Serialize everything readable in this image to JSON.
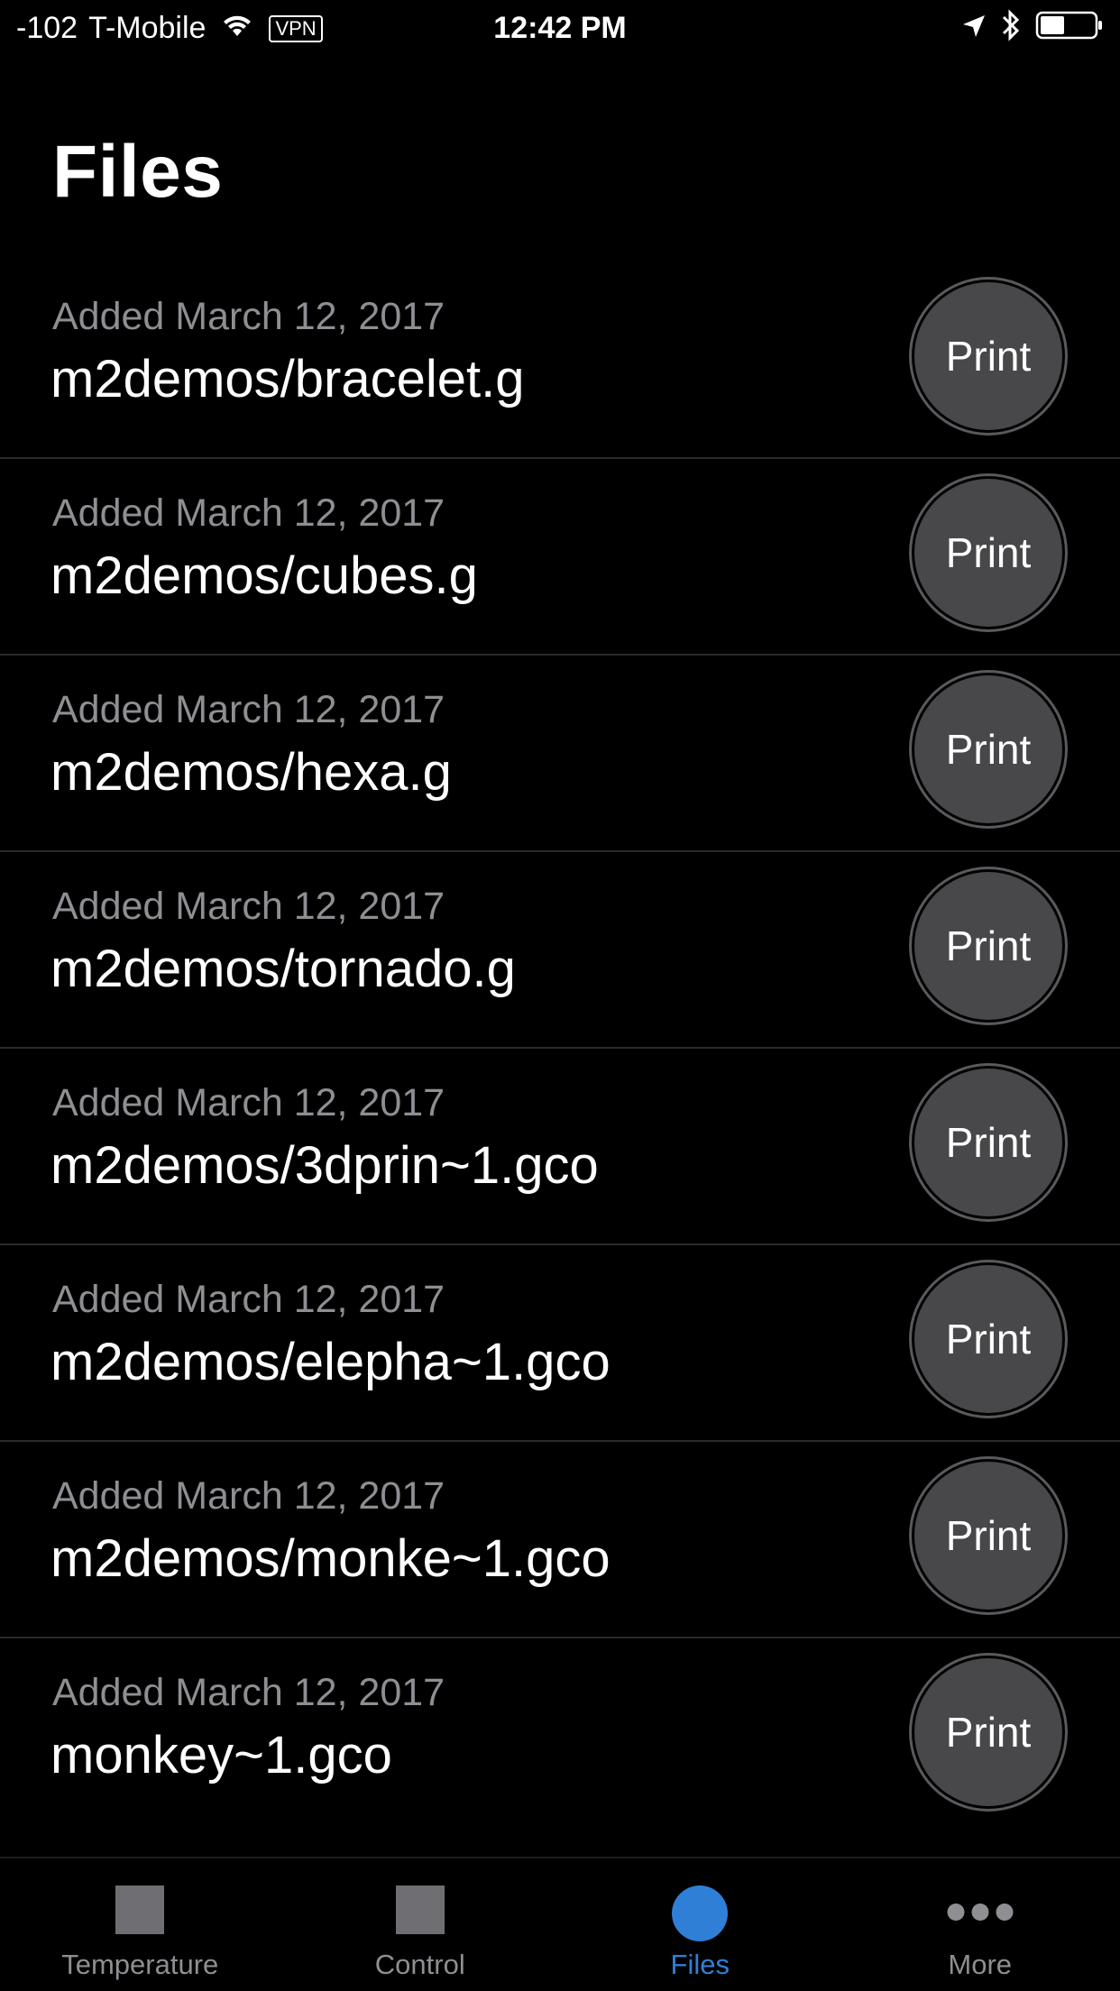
{
  "status_bar": {
    "signal": "-102",
    "carrier": "T-Mobile",
    "vpn": "VPN",
    "time": "12:42 PM"
  },
  "title": "Files",
  "files": [
    {
      "date": "Added March 12, 2017",
      "name": "m2demos/bracelet.g",
      "action": "Print"
    },
    {
      "date": "Added March 12, 2017",
      "name": "m2demos/cubes.g",
      "action": "Print"
    },
    {
      "date": "Added March 12, 2017",
      "name": "m2demos/hexa.g",
      "action": "Print"
    },
    {
      "date": "Added March 12, 2017",
      "name": "m2demos/tornado.g",
      "action": "Print"
    },
    {
      "date": "Added March 12, 2017",
      "name": "m2demos/3dprin~1.gco",
      "action": "Print"
    },
    {
      "date": "Added March 12, 2017",
      "name": "m2demos/elepha~1.gco",
      "action": "Print"
    },
    {
      "date": "Added March 12, 2017",
      "name": "m2demos/monke~1.gco",
      "action": "Print"
    },
    {
      "date": "Added March 12, 2017",
      "name": "monkey~1.gco",
      "action": "Print"
    }
  ],
  "tabs": [
    {
      "label": "Temperature",
      "icon": "square-icon",
      "active": false
    },
    {
      "label": "Control",
      "icon": "square-icon",
      "active": false
    },
    {
      "label": "Files",
      "icon": "circle-icon",
      "active": true
    },
    {
      "label": "More",
      "icon": "more-dots-icon",
      "active": false
    }
  ],
  "colors": {
    "background": "#000000",
    "accent": "#2f7fd6",
    "secondary_text": "#8e8e93",
    "button_fill": "#48484a"
  }
}
